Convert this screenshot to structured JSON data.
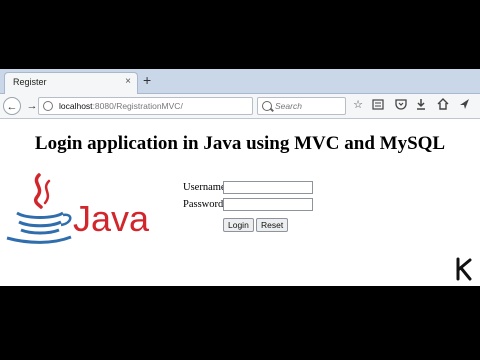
{
  "browser": {
    "tab_title": "Register",
    "tab_close": "×",
    "new_tab": "+",
    "url_host": "localhost",
    "url_path": ":8080/RegistrationMVC/",
    "search_placeholder": "Search",
    "icons": [
      "back-icon",
      "forward-icon",
      "globe-icon",
      "reload-icon",
      "search-icon",
      "star-icon",
      "reading-list-icon",
      "pocket-icon",
      "download-icon",
      "home-icon",
      "share-icon"
    ]
  },
  "page": {
    "title": "Login application in Java using MVC and MySQL",
    "logo_text": "Java",
    "form": {
      "username_label": "Username",
      "password_label": "Password",
      "login_button": "Login",
      "reset_button": "Reset"
    }
  },
  "colors": {
    "java_red": "#d1262b",
    "java_blue": "#2f6dad"
  }
}
